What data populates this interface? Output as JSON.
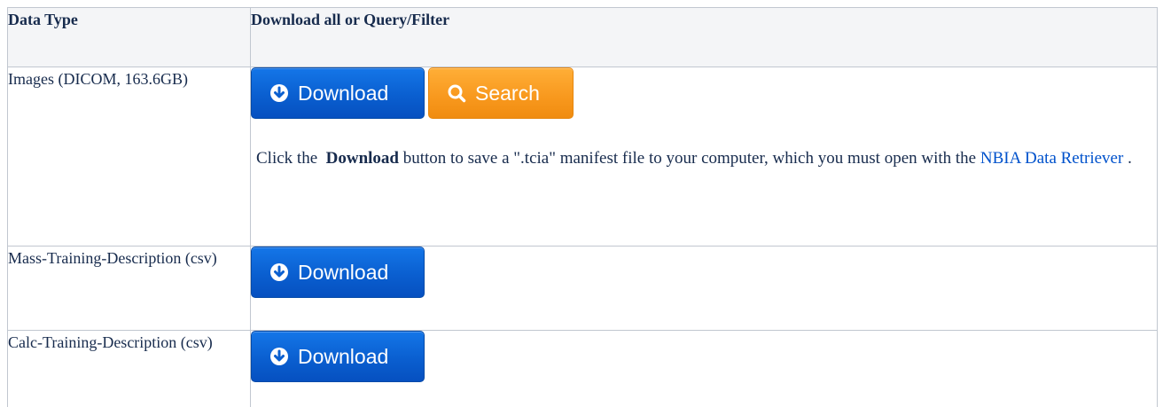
{
  "table": {
    "headers": {
      "data_type": "Data Type",
      "download": "Download all or Query/Filter"
    },
    "rows": [
      {
        "type_label": "Images (DICOM, 163.6GB)",
        "download_label": "Download",
        "search_label": "Search",
        "description": {
          "prefix": "Click the",
          "bold": "Download",
          "middle": "button to save a \".tcia\" manifest file to your computer, which you must open with the",
          "link": "NBIA Data Retriever",
          "suffix": "."
        }
      },
      {
        "type_label": "Mass-Training-Description (csv)",
        "download_label": "Download"
      },
      {
        "type_label": "Calc-Training-Description (csv)",
        "download_label": "Download"
      }
    ]
  },
  "colors": {
    "download_button": "#0a5fd0",
    "search_button": "#f8981d",
    "link": "#0052cc",
    "border": "#c1c7d0",
    "header_bg": "#f4f5f7"
  },
  "icons": {
    "download": "download-circle-icon",
    "search": "search-icon"
  }
}
